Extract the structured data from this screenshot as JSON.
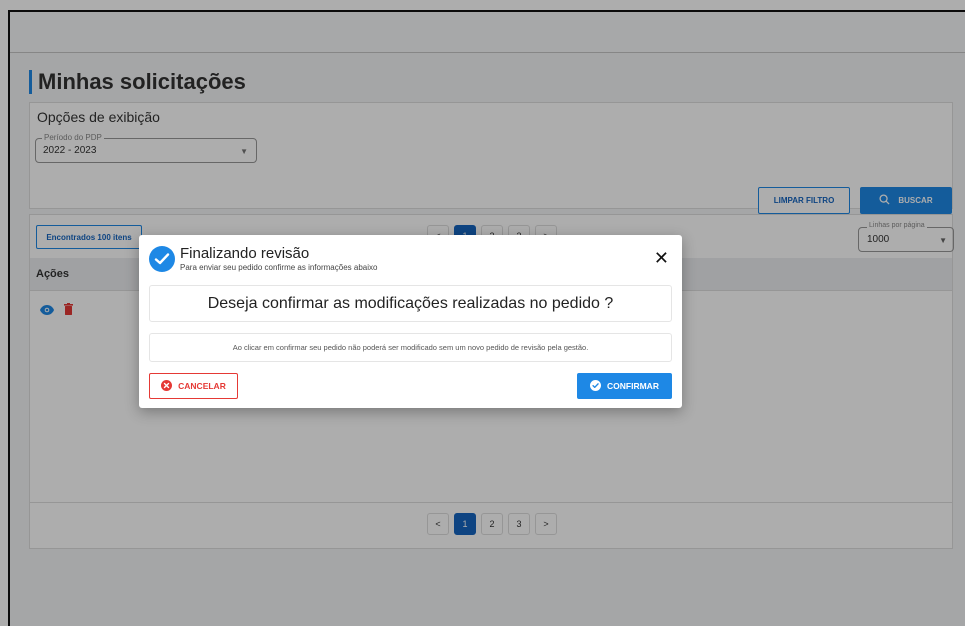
{
  "page": {
    "title": "Minhas solicitações"
  },
  "filters": {
    "title": "Opções de exibição",
    "period_label": "Período do PDP",
    "period_value": "2022 - 2023",
    "clear_label": "LIMPAR FILTRO",
    "search_label": "BUSCAR"
  },
  "table": {
    "found_label": "Encontrados 100 itens",
    "pages": [
      "1",
      "2",
      "3"
    ],
    "active_page": "1",
    "prev_symbol": "<",
    "next_symbol": ">",
    "rows_label": "Linhas por página",
    "rows_value": "1000",
    "header_actions": "Ações"
  },
  "modal": {
    "title": "Finalizando revisão",
    "subtitle": "Para enviar seu pedido confirme as informações abaixo",
    "close_symbol": "✕",
    "question": "Deseja confirmar as modificações realizadas no pedido ?",
    "note": "Ao clicar em confirmar seu pedido não poderá ser modificado sem um novo pedido de revisão pela gestão.",
    "cancel_label": "CANCELAR",
    "confirm_label": "CONFIRMAR"
  },
  "colors": {
    "primary": "#1e88e5",
    "danger": "#e53935",
    "dark_primary": "#1565c0"
  },
  "icons": [
    "search-icon",
    "eye-icon",
    "trash-icon",
    "check-circle-icon",
    "close-icon",
    "cancel-circle-icon",
    "dropdown-arrow-icon"
  ]
}
